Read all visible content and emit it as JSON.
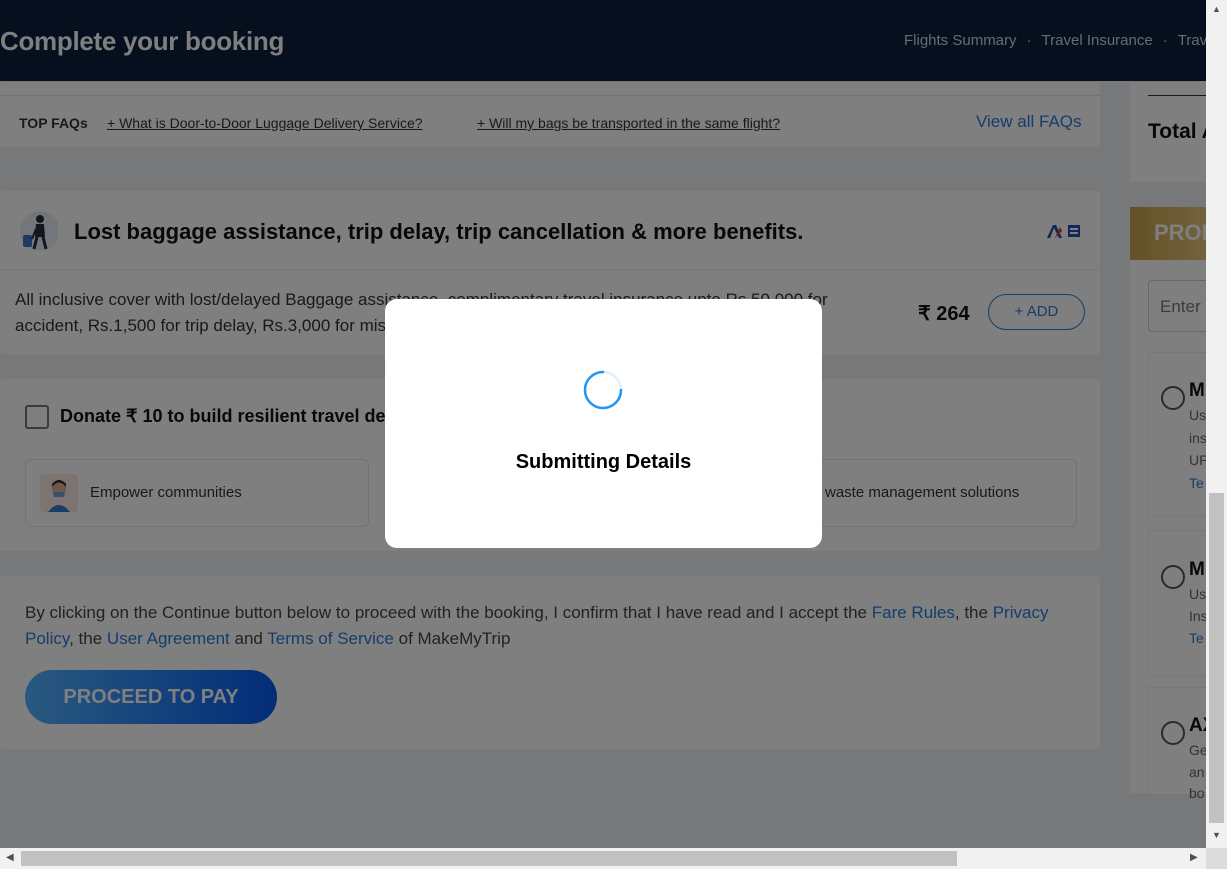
{
  "header": {
    "title": "Complete your booking",
    "nav": [
      "Flights Summary",
      "Travel Insurance",
      "Trav"
    ]
  },
  "faq": {
    "label": "TOP FAQs",
    "q1": "+ What is Door-to-Door Luggage Delivery Service?",
    "q2": "+ Will my bags be transported in the same flight?",
    "view_all": "View all FAQs"
  },
  "insurance": {
    "title": "Lost baggage assistance, trip delay, trip cancellation & more benefits.",
    "description": "All inclusive cover with lost/delayed Baggage assistance, complimentary travel insurance upto Rs.50,000 for accident, Rs.1,500 for trip delay, Rs.3,000 for missed connection.",
    "price": "₹ 264",
    "add_label": "+ ADD"
  },
  "donation": {
    "title": "Donate ₹ 10 to build resilient travel destinations",
    "tile1": "Empower communities",
    "tile3": "waste management solutions"
  },
  "terms": {
    "pre": "By clicking on the Continue button below to proceed with the booking, I confirm that I have read and I accept the",
    "fare_rules": "Fare Rules",
    "sep1": ", the",
    "privacy": "Privacy Policy",
    "sep2": ", the",
    "user_agreement": "User Agreement",
    "and": "and",
    "tos": "Terms of Service",
    "post": "of MakeMyTrip",
    "proceed": "PROCEED TO PAY"
  },
  "sidebar": {
    "total": "Total A",
    "promo_band": "PROM",
    "promo_placeholder": "Enter",
    "coupons": [
      {
        "code": "M",
        "lines": [
          "Us",
          "ins",
          "UP"
        ],
        "link": "Te"
      },
      {
        "code": "M",
        "lines": [
          "Us",
          "Ins"
        ],
        "link": "Te"
      },
      {
        "code": "AX",
        "lines": [
          "Ge",
          "an",
          "bo"
        ],
        "link": ""
      }
    ]
  },
  "modal": {
    "message": "Submitting Details"
  },
  "colors": {
    "header_bg": "#0a1e3a",
    "accent": "#2a7bd6",
    "spinner": "#2196f3"
  }
}
